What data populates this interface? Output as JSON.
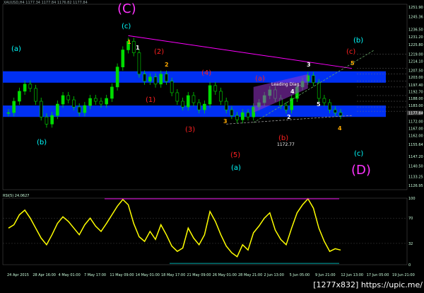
{
  "header": {
    "symbol_line": "XAUUSD,H4 1177.34 1177.84 1176.82 1177.84"
  },
  "rsi_header": "RSI(5) 24.0627",
  "watermark": "[1277x832] https://upic.me/",
  "colors": {
    "background": "#000000",
    "candle": "#00dd00",
    "zone_blue": "#0033ff",
    "channel_magenta": "#ff00ff",
    "rsi_line": "#ffff00",
    "cyan_label": "#00ffff",
    "red_label": "#ff2020",
    "orange_label": "#ffaa00",
    "magenta_label": "#ff33ff",
    "white_label": "#ffffff"
  },
  "chart_data": [
    {
      "type": "candlestick",
      "title": "",
      "instrument": "XAUUSD H4",
      "ylim": [
        1124,
        1254
      ],
      "yticks": [
        "1251.90",
        "1245.36",
        "1236.50",
        "1231.20",
        "1225.80",
        "1219.00",
        "1214.10",
        "1207.50",
        "1203.00",
        "1197.40",
        "1192.70",
        "1188.00",
        "1183.00",
        "1178.00",
        "1172.00",
        "1167.00",
        "1162.00",
        "1155.64",
        "1147.20",
        "1140.50",
        "1133.25",
        "1126.95"
      ],
      "xticks": [
        "24 Apr 2015",
        "28 Apr 16:00",
        "4 May 01:00",
        "7 May 17:00",
        "11 May 09:00",
        "14 May 01:00",
        "18 May 17:00",
        "21 May 09:00",
        "26 May 01:00",
        "28 May 21:00",
        "2 Jun 13:00",
        "5 Jun 05:00",
        "9 Jun 21:00",
        "12 Jun 13:00",
        "17 Jun 05:00",
        "19 Jun 21:00"
      ],
      "price_series": [
        1178,
        1186,
        1193,
        1198,
        1195,
        1186,
        1175,
        1170,
        1176,
        1184,
        1190,
        1187,
        1182,
        1178,
        1183,
        1188,
        1186,
        1184,
        1188,
        1196,
        1210,
        1222,
        1228,
        1220,
        1205,
        1200,
        1203,
        1198,
        1205,
        1200,
        1192,
        1186,
        1182,
        1190,
        1185,
        1180,
        1184,
        1197,
        1193,
        1186,
        1180,
        1176,
        1173,
        1178,
        1175,
        1182,
        1185,
        1190,
        1194,
        1188,
        1183,
        1180,
        1188,
        1196,
        1200,
        1204,
        1199,
        1188,
        1185,
        1180,
        1178,
        1176
      ],
      "current_price": "1177.84",
      "zones": [
        {
          "name": "upper-resistance",
          "from": 1199,
          "to": 1207
        },
        {
          "name": "lower-support",
          "from": 1175,
          "to": 1183
        }
      ],
      "annotations": [
        {
          "text": "(C)",
          "color": "magenta",
          "size": "large"
        },
        {
          "text": "(D)",
          "color": "magenta",
          "size": "large"
        },
        {
          "text": "(a)",
          "color": "cyan"
        },
        {
          "text": "(b)",
          "color": "cyan"
        },
        {
          "text": "(c)",
          "color": "cyan"
        },
        {
          "text": "(a)",
          "color": "cyan"
        },
        {
          "text": "(b)",
          "color": "cyan"
        },
        {
          "text": "(c)",
          "color": "cyan"
        },
        {
          "text": "(2)",
          "color": "red"
        },
        {
          "text": "(1)",
          "color": "red"
        },
        {
          "text": "(4)",
          "color": "red"
        },
        {
          "text": "(3)",
          "color": "red"
        },
        {
          "text": "(5)",
          "color": "red"
        },
        {
          "text": "(a)",
          "color": "red"
        },
        {
          "text": "(b)",
          "color": "red"
        },
        {
          "text": "(c)",
          "color": "red"
        },
        {
          "text": "1",
          "color": "orange"
        },
        {
          "text": "2",
          "color": "orange"
        },
        {
          "text": "3",
          "color": "orange"
        },
        {
          "text": "4",
          "color": "orange"
        },
        {
          "text": "5",
          "color": "orange"
        },
        {
          "text": "1",
          "color": "white"
        },
        {
          "text": "2",
          "color": "white"
        },
        {
          "text": "3",
          "color": "white"
        },
        {
          "text": "4",
          "color": "white"
        },
        {
          "text": "5",
          "color": "white"
        },
        {
          "text": "Leading Diag.",
          "color": "white"
        },
        {
          "text": "1172.77",
          "color": "white"
        }
      ]
    },
    {
      "type": "line",
      "title": "RSI(5) 24.0627",
      "series": [
        {
          "name": "RSI(5)",
          "values": [
            55,
            60,
            75,
            82,
            70,
            55,
            40,
            30,
            45,
            62,
            72,
            65,
            55,
            45,
            60,
            70,
            58,
            50,
            62,
            75,
            88,
            98,
            90,
            62,
            42,
            35,
            50,
            38,
            60,
            45,
            28,
            20,
            25,
            55,
            40,
            30,
            45,
            80,
            65,
            45,
            28,
            18,
            12,
            30,
            22,
            48,
            58,
            70,
            78,
            52,
            38,
            30,
            55,
            78,
            90,
            99,
            85,
            55,
            35,
            20,
            24,
            22
          ]
        }
      ],
      "ylim": [
        0,
        100
      ],
      "yticks": [
        "100",
        "70",
        "32",
        "0"
      ],
      "last_value": "24.0627"
    }
  ]
}
